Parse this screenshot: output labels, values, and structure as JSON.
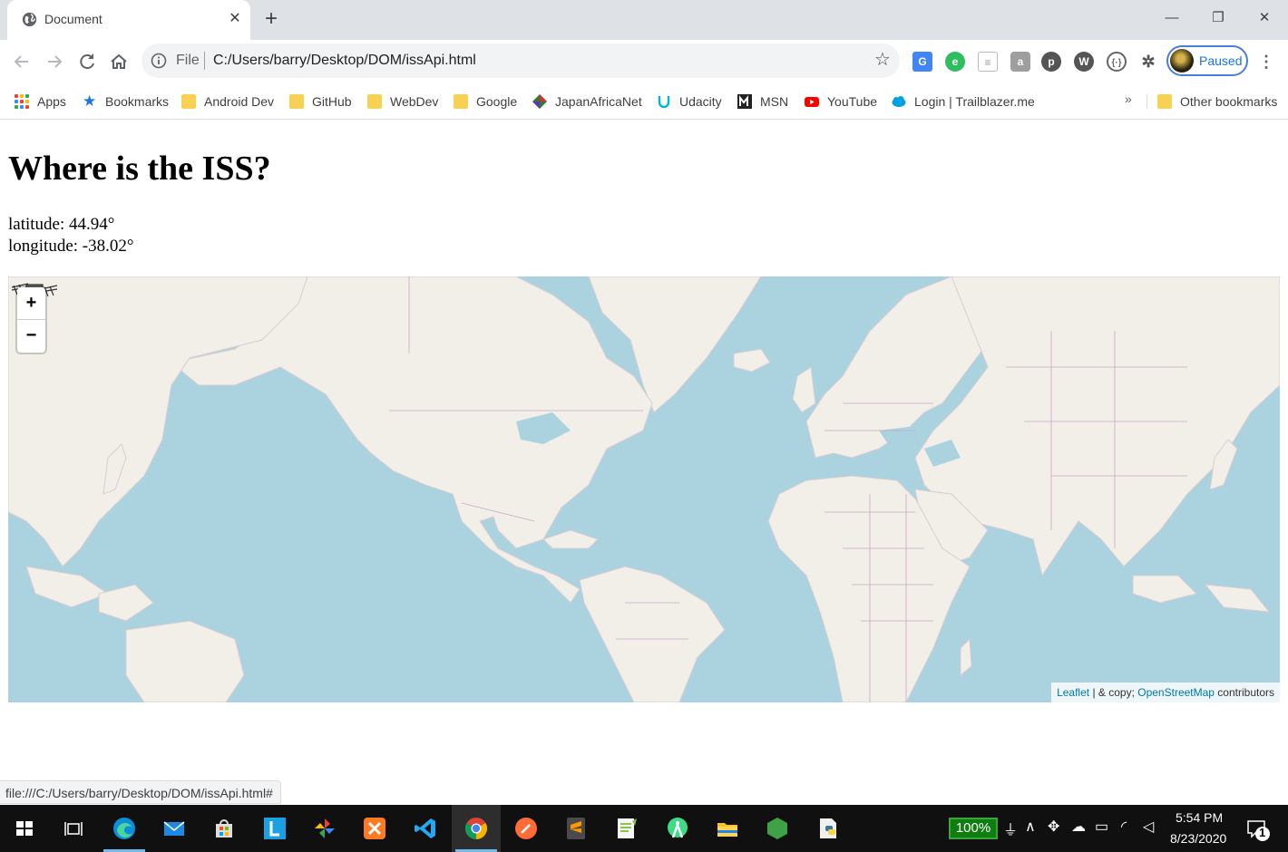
{
  "browser": {
    "tab_title": "Document",
    "tab_close": "✕",
    "new_tab": "+",
    "window_controls": {
      "minimize": "—",
      "restore": "❐",
      "close": "✕"
    },
    "omnibox": {
      "scheme_label": "File",
      "url": "C:/Users/barry/Desktop/DOM/issApi.html"
    },
    "extensions": [
      "google-translate",
      "evernote",
      "reader",
      "android",
      "pinterest",
      "wordpress",
      "code-extension",
      "extensions-puzzle"
    ],
    "profile_label": "Paused",
    "bookmarks": [
      {
        "label": "Apps",
        "icon": "apps-grid-icon"
      },
      {
        "label": "Bookmarks",
        "icon": "star-icon"
      },
      {
        "label": "Android Dev",
        "icon": "folder-icon"
      },
      {
        "label": "GitHub",
        "icon": "folder-icon"
      },
      {
        "label": "WebDev",
        "icon": "folder-icon"
      },
      {
        "label": "Google",
        "icon": "folder-icon"
      },
      {
        "label": "JapanAfricaNet",
        "icon": "diamond-icon"
      },
      {
        "label": "Udacity",
        "icon": "udacity-icon"
      },
      {
        "label": "MSN",
        "icon": "msn-icon"
      },
      {
        "label": "YouTube",
        "icon": "youtube-icon"
      },
      {
        "label": "Login | Trailblazer.me",
        "icon": "salesforce-icon"
      }
    ],
    "bookmarks_overflow": "»",
    "other_bookmarks": "Other bookmarks",
    "status_url": "file:///C:/Users/barry/Desktop/DOM/issApi.html#"
  },
  "page": {
    "heading": "Where is the ISS?",
    "latitude_text": "latitude: 44.94°",
    "longitude_text": "longitude: -38.02°",
    "latitude": 44.94,
    "longitude": -38.02,
    "map": {
      "zoom_in": "+",
      "zoom_out": "−",
      "attribution": {
        "leaflet": "Leaflet",
        "middle": " | & copy; ",
        "osm": "OpenStreetMap",
        "suffix": " contributors"
      },
      "colors": {
        "water": "#aad3df",
        "land": "#f2efe9",
        "border": "#c9a8c3",
        "link": "#0078a8"
      }
    }
  },
  "taskbar": {
    "apps": [
      "start",
      "task-view",
      "edge",
      "mail",
      "store",
      "lexia",
      "photos",
      "xampp",
      "vscode",
      "chrome",
      "postman",
      "sublime",
      "notepad-plus",
      "android-studio",
      "file-explorer",
      "nodejs",
      "python-editor"
    ],
    "active_app": "chrome",
    "battery": "100%",
    "time": "5:54 PM",
    "date": "8/23/2020",
    "notification_count": "1"
  }
}
